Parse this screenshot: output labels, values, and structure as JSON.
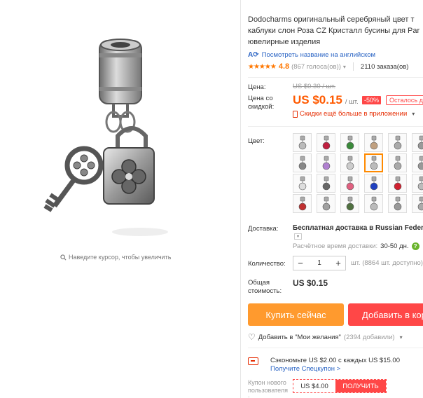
{
  "product": {
    "title_lines": [
      "Dodocharms оригинальный серебряный цвет т",
      "каблуки слон Роза CZ Кристалл бусины для Par",
      "ювелирные изделия"
    ],
    "translate_link": "Посмотреть название на английском",
    "zoom_hint": "Наведите курсор, чтобы увеличить"
  },
  "rating": {
    "stars": "★★★★★",
    "value": "4.8",
    "votes": "(867 голоса(ов))",
    "orders": "2110 заказа(ов)"
  },
  "price": {
    "label": "Цена:",
    "old": "US $0.30 / шт.",
    "discount_label_1": "Цена со",
    "discount_label_2": "скидкой:",
    "new_amount": "US $0.15",
    "unit": "/ шт.",
    "discount_badge": "-50%",
    "remaining_badge": "Осталось д",
    "app_discount": "Скидки ещё больше в приложении"
  },
  "color": {
    "label": "Цвет:",
    "selected_index": 9
  },
  "shipping": {
    "label": "Доставка:",
    "text": "Бесплатная доставка в Russian Federation",
    "est_label": "Расчётное время доставки:",
    "est_days": "30-50 дн."
  },
  "quantity": {
    "label": "Количество:",
    "value": "1",
    "minus": "−",
    "plus": "+",
    "available": "шт. (8864 шт. доступно)"
  },
  "total": {
    "label_1": "Общая",
    "label_2": "стоимость:",
    "value": "US $0.15"
  },
  "actions": {
    "buy_now": "Купить сейчас",
    "add_to_cart": "Добавить в корзину",
    "wishlist": "Добавить в \"Мои желания\"",
    "wishlist_count": "(2394 добавили)"
  },
  "coupon": {
    "savings": "Сэкономьте US $2.00 с каждых US $15.00",
    "get_coupon_link": "Получите Спецкупон >",
    "new_user_label_1": "Купон нового",
    "new_user_label_2": "пользователя",
    "new_user_label_3": ":",
    "amount": "US $4.00",
    "get_button": "ПОЛУЧИТЬ"
  },
  "colors": {
    "accent_orange": "#ff5a00",
    "buy_now_bg": "#ff9a2e",
    "cart_bg": "#ff4747",
    "link_blue": "#2a64c4"
  }
}
